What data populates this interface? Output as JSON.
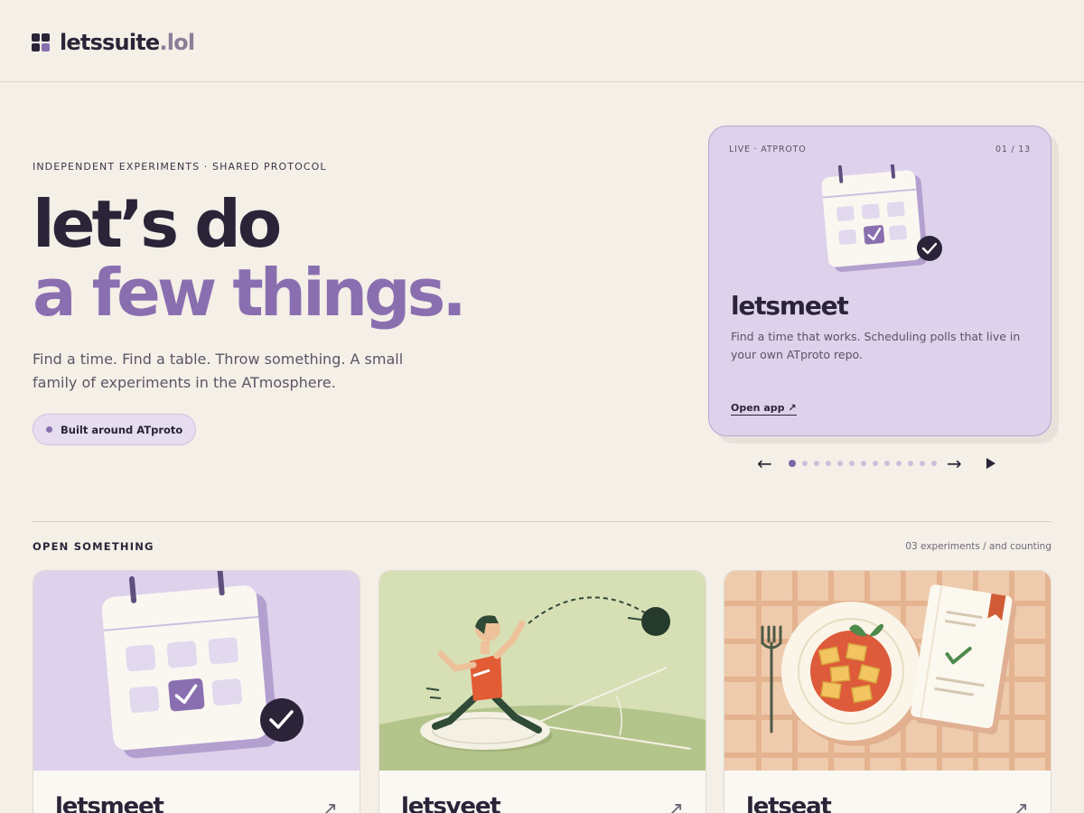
{
  "header": {
    "brand": "letssuite",
    "brand_tld": ".lol"
  },
  "hero": {
    "eyebrow": "INDEPENDENT EXPERIMENTS · SHARED PROTOCOL",
    "headline_line1": "let’s do",
    "headline_line2": "a few things.",
    "lede": "Find a time. Find a table. Throw something. A small family of experiments in the ATmosphere.",
    "pill": "Built around ATproto"
  },
  "feature": {
    "status": "LIVE · ATPROTO",
    "counter": "01 / 13",
    "title": "letsmeet",
    "description": "Find a time that works. Scheduling polls that live in your own ATproto repo.",
    "link": "Open app ↗",
    "art_icon": "calendar-check-icon"
  },
  "carousel": {
    "prev": "←",
    "next": "→",
    "dot_count": 13,
    "active_index": 0
  },
  "section": {
    "title": "OPEN SOMETHING",
    "meta": "03 experiments / and counting"
  },
  "cards": [
    {
      "title": "letsmeet",
      "link_glyph": "↗",
      "art_icon": "calendar-check-icon"
    },
    {
      "title": "letsyeet",
      "link_glyph": "↗",
      "art_icon": "shot-put-thrower-icon"
    },
    {
      "title": "letseat",
      "link_glyph": "↗",
      "art_icon": "dinner-plate-menu-icon"
    }
  ],
  "colors": {
    "background": "#f4efe7",
    "ink": "#2b2438",
    "accent": "#8a6fb0",
    "lavender": "#ddd1ec",
    "sage": "#d7dfb5",
    "peach": "#efcbad"
  }
}
